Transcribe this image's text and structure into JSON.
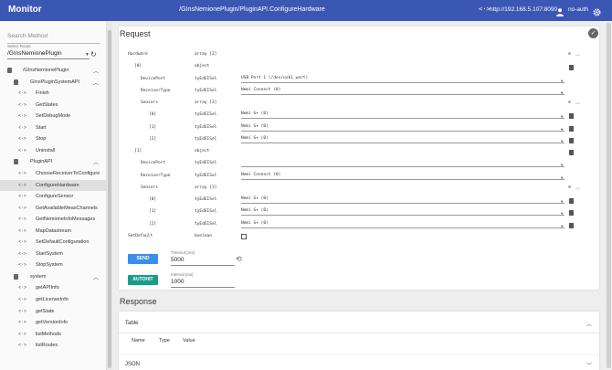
{
  "app": {
    "title": "Monitor",
    "route_title": "/GInsNemionePlugin/PluginAPI.ConfigureHardware",
    "url": "http://192.168.5.107:8090",
    "user": "no-auth"
  },
  "sidebar": {
    "search_placeholder": "Search Method",
    "route_label": "Select Route",
    "route_value": "/GInsNemionePlugin",
    "tree": [
      {
        "label": "/GInsNemionePlugin",
        "kind": "root"
      },
      {
        "label": "GInsPluginSystemAPI",
        "kind": "group"
      },
      {
        "label": "Finish",
        "kind": "method"
      },
      {
        "label": "GetStates",
        "kind": "method"
      },
      {
        "label": "SetDebugMode",
        "kind": "method"
      },
      {
        "label": "Start",
        "kind": "method"
      },
      {
        "label": "Stop",
        "kind": "method"
      },
      {
        "label": "Uninstall",
        "kind": "method"
      },
      {
        "label": "PluginAPI",
        "kind": "group"
      },
      {
        "label": "ChooseReceiverToConfigure",
        "kind": "method"
      },
      {
        "label": "ConfigureHardware",
        "kind": "method",
        "active": true
      },
      {
        "label": "ConfigureSensor",
        "kind": "method"
      },
      {
        "label": "GetAvailableMeasChannels",
        "kind": "method"
      },
      {
        "label": "GetNemioneInfoMessages",
        "kind": "method"
      },
      {
        "label": "MapDatastream",
        "kind": "method"
      },
      {
        "label": "SetDefaultConfiguration",
        "kind": "method"
      },
      {
        "label": "StartSystem",
        "kind": "method"
      },
      {
        "label": "StopSystem",
        "kind": "method"
      },
      {
        "label": "system",
        "kind": "group"
      },
      {
        "label": "getAPIInfo",
        "kind": "method"
      },
      {
        "label": "getLicenseInfo",
        "kind": "method"
      },
      {
        "label": "getState",
        "kind": "method"
      },
      {
        "label": "getVersionInfo",
        "kind": "method"
      },
      {
        "label": "listMethods",
        "kind": "method"
      },
      {
        "label": "listRoutes",
        "kind": "method"
      }
    ]
  },
  "request": {
    "title": "Request",
    "rows": [
      {
        "name": "Hardware",
        "type": "array [2]",
        "indent": 0
      },
      {
        "name": "[0]",
        "type": "object",
        "indent": 1
      },
      {
        "name": "DevicePort",
        "type": "tyEdEISel",
        "indent": 2,
        "value": "USB Port 1 (/dev/usb1_wart)"
      },
      {
        "name": "ReceiverType",
        "type": "tyEdEISel",
        "indent": 2,
        "value": "Nemi Connect (0)"
      },
      {
        "name": "Sensors",
        "type": "array [3]",
        "indent": 2
      },
      {
        "name": "[0]",
        "type": "tyEdEISel",
        "indent": 3,
        "value": "Nemi G+ (0)"
      },
      {
        "name": "[1]",
        "type": "tyEdEISel",
        "indent": 3,
        "value": "Nemi G+ (0)"
      },
      {
        "name": "[2]",
        "type": "tyEdEISel",
        "indent": 3,
        "value": "Nemi G+ (0)"
      },
      {
        "name": "[1]",
        "type": "object",
        "indent": 1
      },
      {
        "name": "DevicePort",
        "type": "tyEdEISel",
        "indent": 2,
        "value": ""
      },
      {
        "name": "ReceiverType",
        "type": "tyEdEISel",
        "indent": 2,
        "value": "Nemi Connect (0)"
      },
      {
        "name": "Sensors",
        "type": "array [3]",
        "indent": 2
      },
      {
        "name": "[0]",
        "type": "tyEdEISel",
        "indent": 3,
        "value": "Nemi G+ (0)"
      },
      {
        "name": "[1]",
        "type": "tyEdEISel",
        "indent": 3,
        "value": "Nemi G+ (0)"
      },
      {
        "name": "[2]",
        "type": "tyEdEISel",
        "indent": 3,
        "value": "Nemi G+ (0)"
      },
      {
        "name": "SetDefault",
        "type": "boolean",
        "indent": 0
      }
    ],
    "send_label": "SEND",
    "autohit_label": "AUTOHIT",
    "timeout_label": "Timeout [ms]",
    "timeout_value": "5000",
    "interval_label": "Interval [ms]",
    "interval_value": "1000"
  },
  "response": {
    "title": "Response",
    "table_label": "Table",
    "columns": [
      "Name",
      "Type",
      "Value"
    ],
    "json_label": "JSON"
  }
}
